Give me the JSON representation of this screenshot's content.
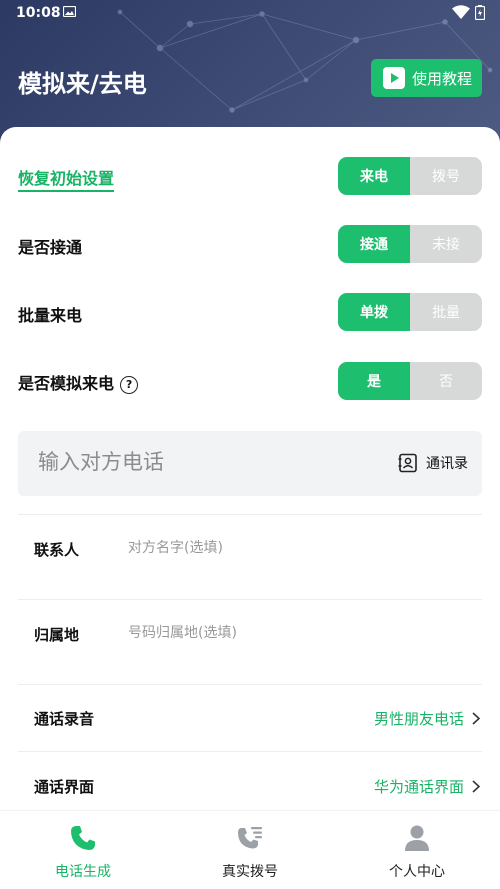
{
  "status_bar": {
    "time": "10:08"
  },
  "header": {
    "title": "模拟来/去电",
    "tutorial_label": "使用教程"
  },
  "settings": {
    "reset_label": "恢复初始设置",
    "call_direction": {
      "options": [
        "来电",
        "拨号"
      ],
      "selected": "来电"
    },
    "connect": {
      "label": "是否接通",
      "options": [
        "接通",
        "未接"
      ],
      "selected": "接通"
    },
    "batch": {
      "label": "批量来电",
      "options": [
        "单拨",
        "批量"
      ],
      "selected": "单拨"
    },
    "simulate": {
      "label": "是否模拟来电",
      "help": "?",
      "options": [
        "是",
        "否"
      ],
      "selected": "是"
    }
  },
  "phone": {
    "placeholder": "输入对方电话",
    "contacts_label": "通讯录"
  },
  "contact": {
    "label": "联系人",
    "placeholder": "对方名字(选填)"
  },
  "location": {
    "label": "归属地",
    "placeholder": "号码归属地(选填)"
  },
  "recording": {
    "label": "通话录音",
    "value": "男性朋友电话"
  },
  "interface": {
    "label": "通话界面",
    "value": "华为通话界面"
  },
  "bottom_nav": [
    {
      "label": "电话生成",
      "icon": "phone-icon",
      "active": true
    },
    {
      "label": "真实拨号",
      "icon": "dial-icon",
      "active": false
    },
    {
      "label": "个人中心",
      "icon": "person-icon",
      "active": false
    }
  ],
  "colors": {
    "accent": "#1dbf6e",
    "header_bg": "#2c3a63",
    "inactive_segment": "#d6d9d8"
  }
}
